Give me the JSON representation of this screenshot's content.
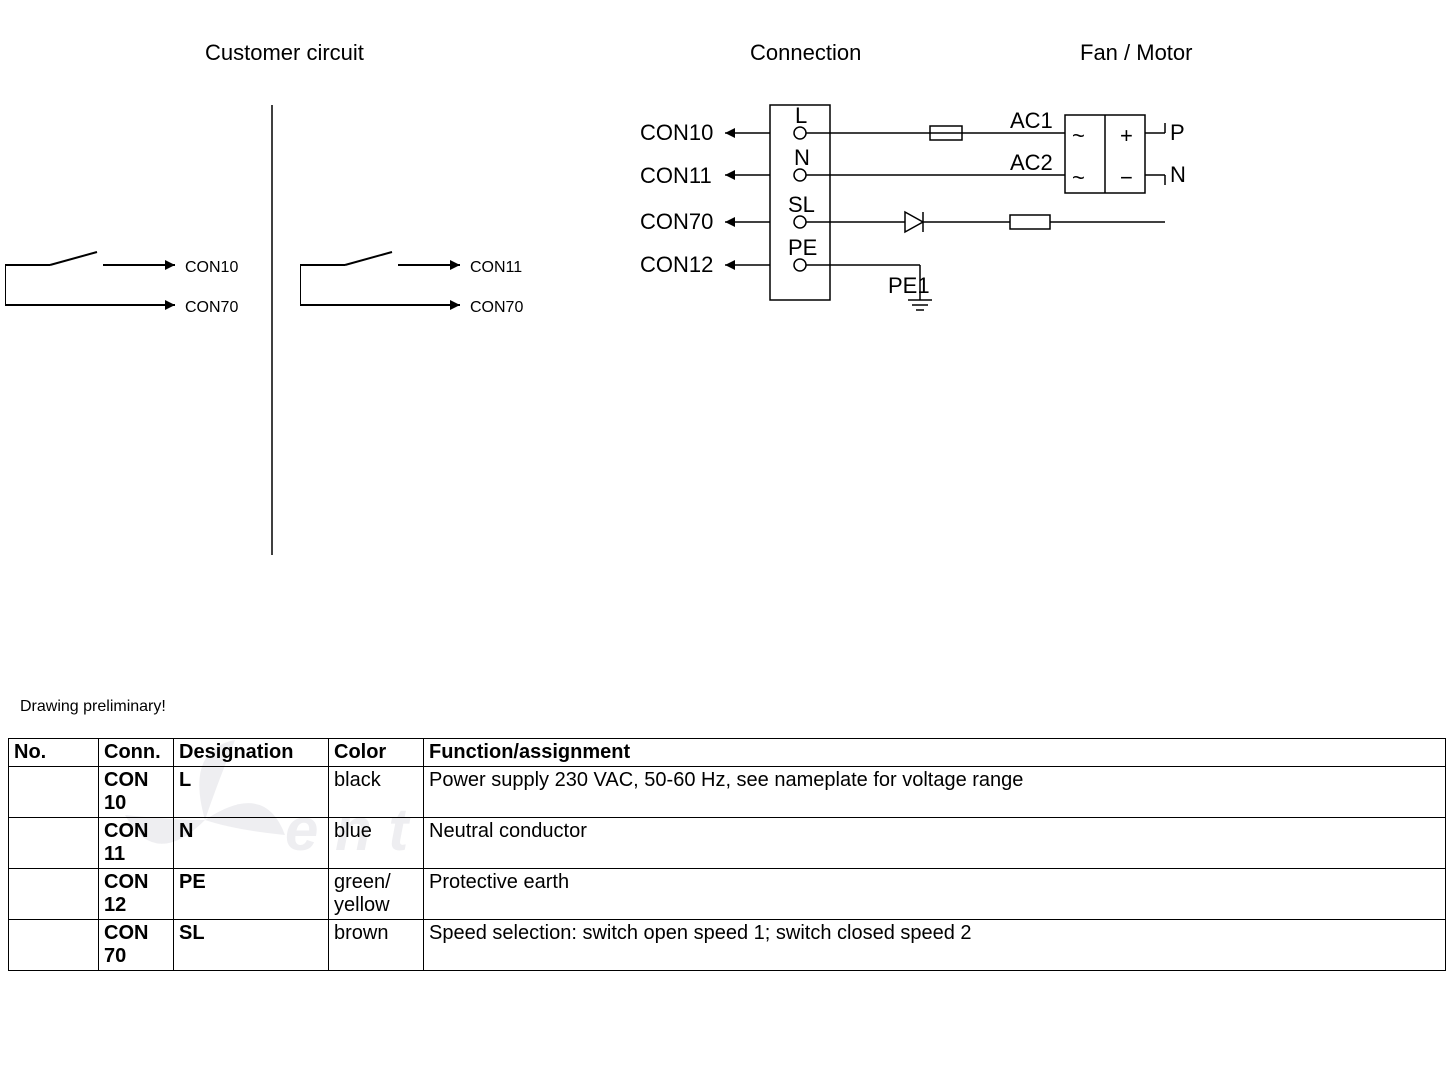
{
  "headers": {
    "customer_circuit": "Customer circuit",
    "connection": "Connection",
    "fan_motor": "Fan / Motor"
  },
  "switch_left": {
    "out1": "CON10",
    "out2": "CON70"
  },
  "switch_right": {
    "out1": "CON11",
    "out2": "CON70"
  },
  "connection_block": {
    "row1": {
      "label": "CON10",
      "terminal": "L"
    },
    "row2": {
      "label": "CON11",
      "terminal": "N"
    },
    "row3": {
      "label": "CON70",
      "terminal": "SL"
    },
    "row4": {
      "label": "CON12",
      "terminal": "PE"
    },
    "ac1": "AC1",
    "ac2": "AC2",
    "p": "P",
    "n": "N",
    "plus": "+",
    "minus": "−",
    "tilde1": "~",
    "tilde2": "~",
    "pe1": "PE1"
  },
  "preliminary": "Drawing preliminary!",
  "table": {
    "headers": {
      "no": "No.",
      "conn": "Conn.",
      "designation": "Designation",
      "color": "Color",
      "function": "Function/assignment"
    },
    "rows": [
      {
        "no": "",
        "conn": "CON 10",
        "designation": "L",
        "color": "black",
        "function": "Power supply 230 VAC, 50-60 Hz, see nameplate for voltage range"
      },
      {
        "no": "",
        "conn": "CON 11",
        "designation": "N",
        "color": "blue",
        "function": "Neutral conductor"
      },
      {
        "no": "",
        "conn": "CON 12",
        "designation": "PE",
        "color": "green/ yellow",
        "function": "Protective earth"
      },
      {
        "no": "",
        "conn": "CON 70",
        "designation": "SL",
        "color": "brown",
        "function": "Speed selection: switch open speed 1; switch closed speed 2"
      }
    ]
  }
}
